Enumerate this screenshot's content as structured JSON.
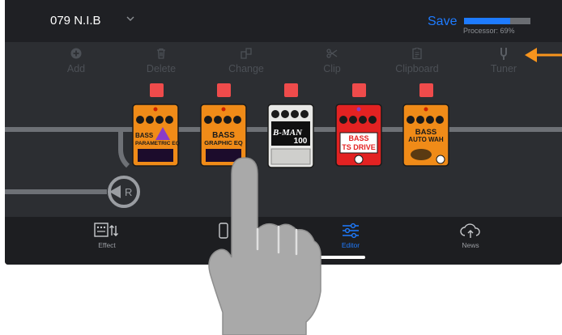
{
  "header": {
    "preset_name": "079 N.I.B",
    "save_label": "Save",
    "processor_label": "Processor: 69%",
    "processor_percent": 69
  },
  "toolbar": {
    "items": [
      {
        "label": "Add",
        "icon": "add-icon"
      },
      {
        "label": "Delete",
        "icon": "trash-icon"
      },
      {
        "label": "Change",
        "icon": "swap-icon"
      },
      {
        "label": "Clip",
        "icon": "scissors-icon"
      },
      {
        "label": "Clipboard",
        "icon": "clipboard-icon"
      },
      {
        "label": "Tuner",
        "icon": "tuning-fork-icon"
      }
    ]
  },
  "pedals": [
    {
      "name": "BASS PARAMETRIC EQ",
      "line1": "BASS",
      "line2": "PARAMETRIC EQ",
      "color": "#f08b18"
    },
    {
      "name": "BASS GRAPHIC EQ",
      "line1": "BASS",
      "line2": "GRAPHIC EQ",
      "color": "#f08b18"
    },
    {
      "name": "B-MAN 100",
      "line1": "B-MAN",
      "line2": "100",
      "color": "#e8e8e6"
    },
    {
      "name": "BASS TS DRIVE",
      "line1": "BASS",
      "line2": "TS DRIVE",
      "color": "#e32222"
    },
    {
      "name": "BASS AUTO WAH",
      "line1": "BASS",
      "line2": "AUTO WAH",
      "color": "#f08b18"
    }
  ],
  "return_node_label": "R",
  "tabs": [
    {
      "label": "Effect",
      "icon": "effect-icon",
      "active": false
    },
    {
      "label": "",
      "icon": "phone-icon",
      "active": false
    },
    {
      "label": "Editor",
      "icon": "sliders-icon",
      "active": true
    },
    {
      "label": "News",
      "icon": "cloud-icon",
      "active": false
    }
  ],
  "colors": {
    "accent": "#1e7bff",
    "select": "#ef4b4b",
    "annotation_arrow": "#f7941d",
    "pedal_orange": "#f08b18",
    "pedal_red": "#e32222"
  }
}
